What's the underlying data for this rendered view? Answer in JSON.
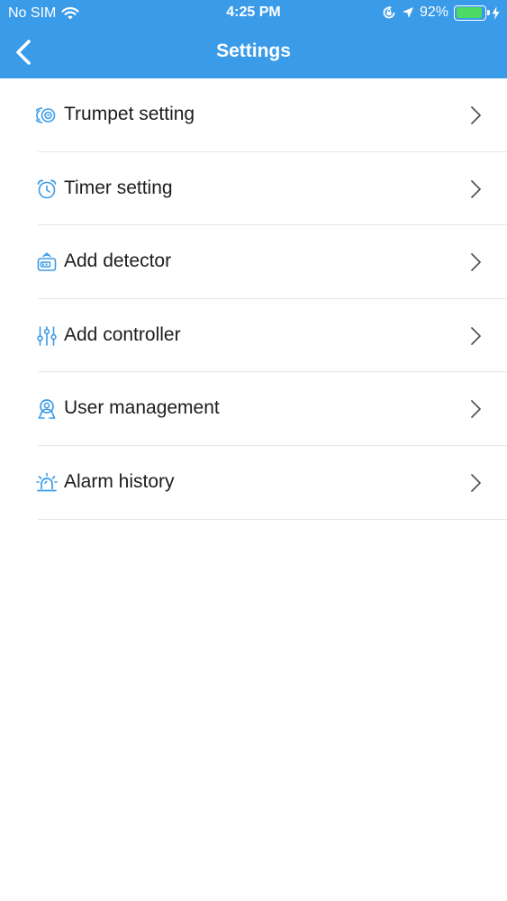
{
  "status_bar": {
    "carrier": "No SIM",
    "time": "4:25 PM",
    "battery": "92%",
    "battery_level": 0.92
  },
  "nav": {
    "title": "Settings",
    "back_icon": "chevron-left-icon"
  },
  "menu": {
    "items": [
      {
        "label": "Trumpet setting",
        "icon": "speaker-icon"
      },
      {
        "label": "Timer setting",
        "icon": "alarm-clock-icon"
      },
      {
        "label": "Add detector",
        "icon": "detector-icon"
      },
      {
        "label": "Add controller",
        "icon": "sliders-icon"
      },
      {
        "label": "User management",
        "icon": "user-icon"
      },
      {
        "label": "Alarm history",
        "icon": "siren-icon"
      }
    ]
  },
  "colors": {
    "header_bg": "#3a9be8",
    "icon": "#3a9be8",
    "battery_fill": "#4cd964"
  }
}
